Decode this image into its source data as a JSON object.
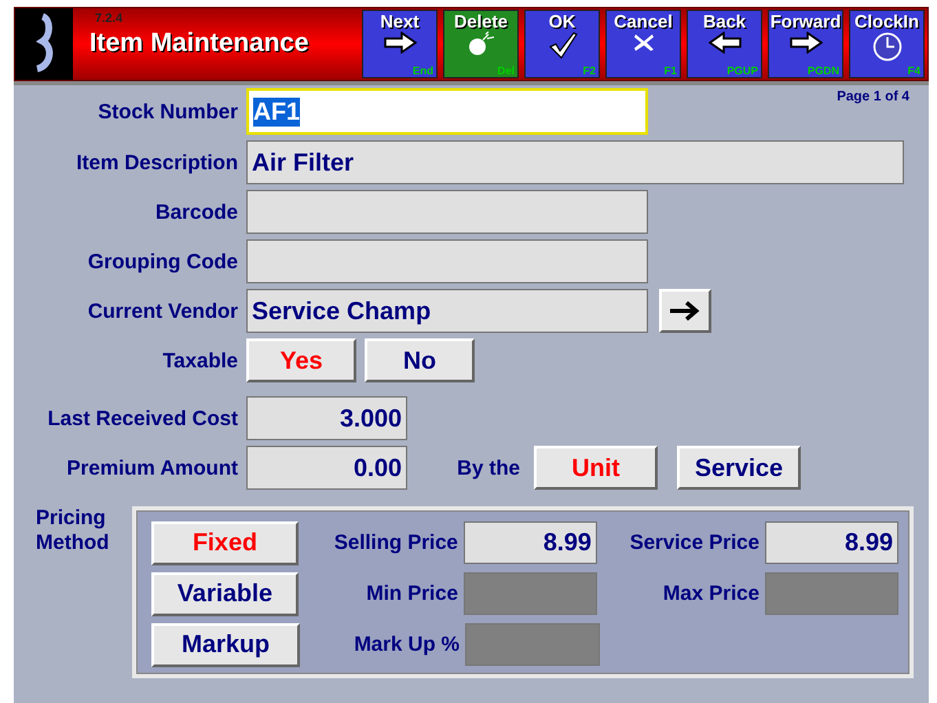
{
  "header": {
    "version": "7.2.4",
    "title": "Item Maintenance"
  },
  "toolbar": [
    {
      "label": "Next",
      "kind": "forward",
      "key": "End",
      "color": "#3b3bd8"
    },
    {
      "label": "Delete",
      "kind": "delete",
      "key": "Del",
      "color": "#228b22"
    },
    {
      "label": "OK",
      "kind": "confirm",
      "key": "F2",
      "color": "#3b3bd8"
    },
    {
      "label": "Cancel",
      "kind": "cancel",
      "key": "F1",
      "color": "#3b3bd8"
    },
    {
      "label": "Back",
      "kind": "back",
      "key": "PGUP",
      "color": "#3b3bd8"
    },
    {
      "label": "Forward",
      "kind": "forward",
      "key": "PGDN",
      "color": "#3b3bd8"
    },
    {
      "label": "ClockIn",
      "kind": "clock",
      "key": "F4",
      "color": "#3b3bd8"
    }
  ],
  "page_indicator": "Page 1 of 4",
  "fields": [
    {
      "label": "Stock Number",
      "value": "AF1",
      "focused": true
    },
    {
      "label": "Item Description",
      "value": "Air Filter",
      "focused": false
    },
    {
      "label": "Barcode",
      "focused": false
    },
    {
      "label": "Grouping Code",
      "focused": false
    },
    {
      "label": "Current Vendor",
      "value": "Service Champ",
      "focused": false,
      "lookup": true
    }
  ],
  "taxable": {
    "label": "Taxable",
    "options": [
      {
        "label": "Yes",
        "selected": true
      },
      {
        "label": "No",
        "selected": false
      }
    ]
  },
  "last_received_cost": {
    "label": "Last Received Cost",
    "value": "3.000"
  },
  "premium_amount": {
    "label": "Premium Amount",
    "value": "0.00"
  },
  "by_the": {
    "label": "By the",
    "options": [
      {
        "label": "Unit",
        "selected": true
      },
      {
        "label": "Service",
        "selected": false
      }
    ]
  },
  "pricing": {
    "label": "Pricing Method",
    "rows": [
      {
        "method": {
          "label": "Fixed",
          "selected": true
        },
        "fields": [
          {
            "label": "Selling Price",
            "value": "8.99",
            "disabled": false
          },
          {
            "label": "Service Price",
            "value": "8.99",
            "disabled": false
          }
        ]
      },
      {
        "method": {
          "label": "Variable",
          "selected": false
        },
        "fields": [
          {
            "label": "Min Price",
            "disabled": true
          },
          {
            "label": "Max Price",
            "disabled": true
          }
        ]
      },
      {
        "method": {
          "label": "Markup",
          "selected": false
        },
        "fields": [
          {
            "label": "Mark Up %",
            "disabled": true
          }
        ]
      }
    ]
  }
}
